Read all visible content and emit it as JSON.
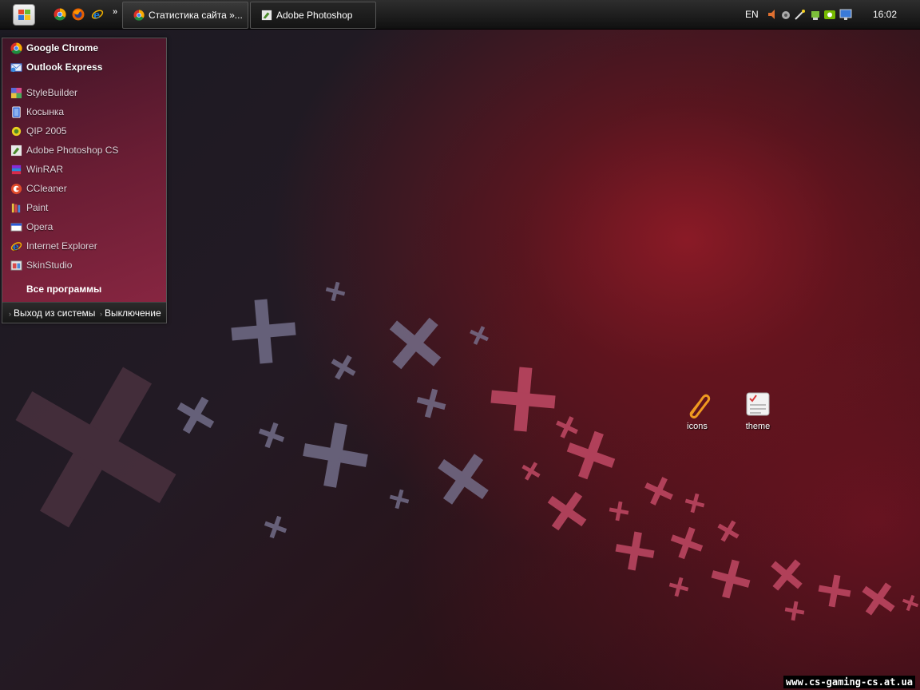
{
  "taskbar": {
    "quick_launch": [
      "chrome-icon",
      "firefox-icon",
      "ie-icon"
    ],
    "more_symbol": "»",
    "tasks": [
      {
        "label": "Статистика сайта »...",
        "icon": "chrome-icon",
        "active": false
      },
      {
        "label": "Adobe Photoshop",
        "icon": "photoshop-icon",
        "active": true
      }
    ],
    "tray": {
      "language": "EN",
      "icons": [
        "volume-icon",
        "network-icon",
        "wand-icon",
        "hardware-icon",
        "nvidia-icon",
        "monitor-icon"
      ],
      "clock": "16:02"
    }
  },
  "start_menu": {
    "pinned": [
      {
        "label": "Google Chrome",
        "icon": "chrome-icon"
      },
      {
        "label": "Outlook Express",
        "icon": "outlook-icon"
      }
    ],
    "recent": [
      {
        "label": "StyleBuilder",
        "icon": "stylebuilder-icon"
      },
      {
        "label": "Косынка",
        "icon": "solitaire-icon"
      },
      {
        "label": "QIP 2005",
        "icon": "qip-icon"
      },
      {
        "label": "Adobe Photoshop CS",
        "icon": "photoshop-icon"
      },
      {
        "label": "WinRAR",
        "icon": "winrar-icon"
      },
      {
        "label": "CCleaner",
        "icon": "ccleaner-icon"
      },
      {
        "label": "Paint",
        "icon": "paint-icon"
      },
      {
        "label": "Opera",
        "icon": "opera-icon"
      },
      {
        "label": "Internet Explorer",
        "icon": "ie-icon"
      },
      {
        "label": "SkinStudio",
        "icon": "skinstudio-icon"
      }
    ],
    "all_programs": "Все программы",
    "logoff": "Выход из системы",
    "shutdown": "Выключение"
  },
  "desktop_icons": [
    {
      "label": "icons",
      "icon": "paperclip-icon"
    },
    {
      "label": "theme",
      "icon": "theme-icon"
    }
  ],
  "watermark": "www.cs-gaming-cs.at.ua",
  "colors": {
    "menu_accent": "#8a1a3a",
    "taskbar": "#1a1a1a"
  }
}
